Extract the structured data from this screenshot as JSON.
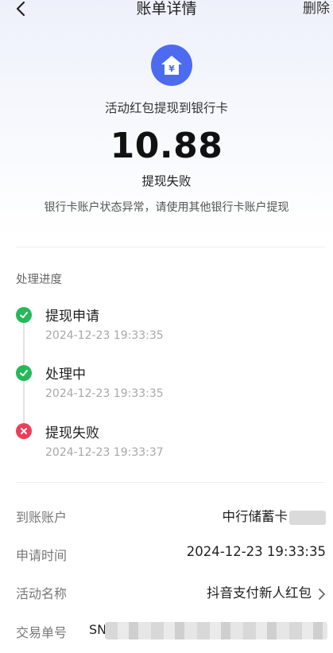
{
  "nav": {
    "title": "账单详情",
    "delete_label": "删除"
  },
  "summary": {
    "icon": "yuan-house-icon",
    "title": "活动红包提现到银行卡",
    "amount": "10.88",
    "status": "提现失败",
    "reason": "银行卡账户状态异常，请使用其他银行卡账户提现"
  },
  "progress": {
    "label": "处理进度",
    "steps": [
      {
        "title": "提现申请",
        "time": "2024-12-23 19:33:35",
        "state": "success"
      },
      {
        "title": "处理中",
        "time": "2024-12-23 19:33:35",
        "state": "success"
      },
      {
        "title": "提现失败",
        "time": "2024-12-23 19:33:37",
        "state": "failed"
      }
    ]
  },
  "details": {
    "account_label": "到账账户",
    "account_value": "中行储蓄卡",
    "apply_time_label": "申请时间",
    "apply_time_value": "2024-12-23 19:33:35",
    "activity_label": "活动名称",
    "activity_value": "抖音支付新人红包",
    "txn_label": "交易单号",
    "txn_prefix": "SN"
  },
  "colors": {
    "accent": "#4c6bf0",
    "success": "#26b85a",
    "failed": "#ee3d5a"
  }
}
